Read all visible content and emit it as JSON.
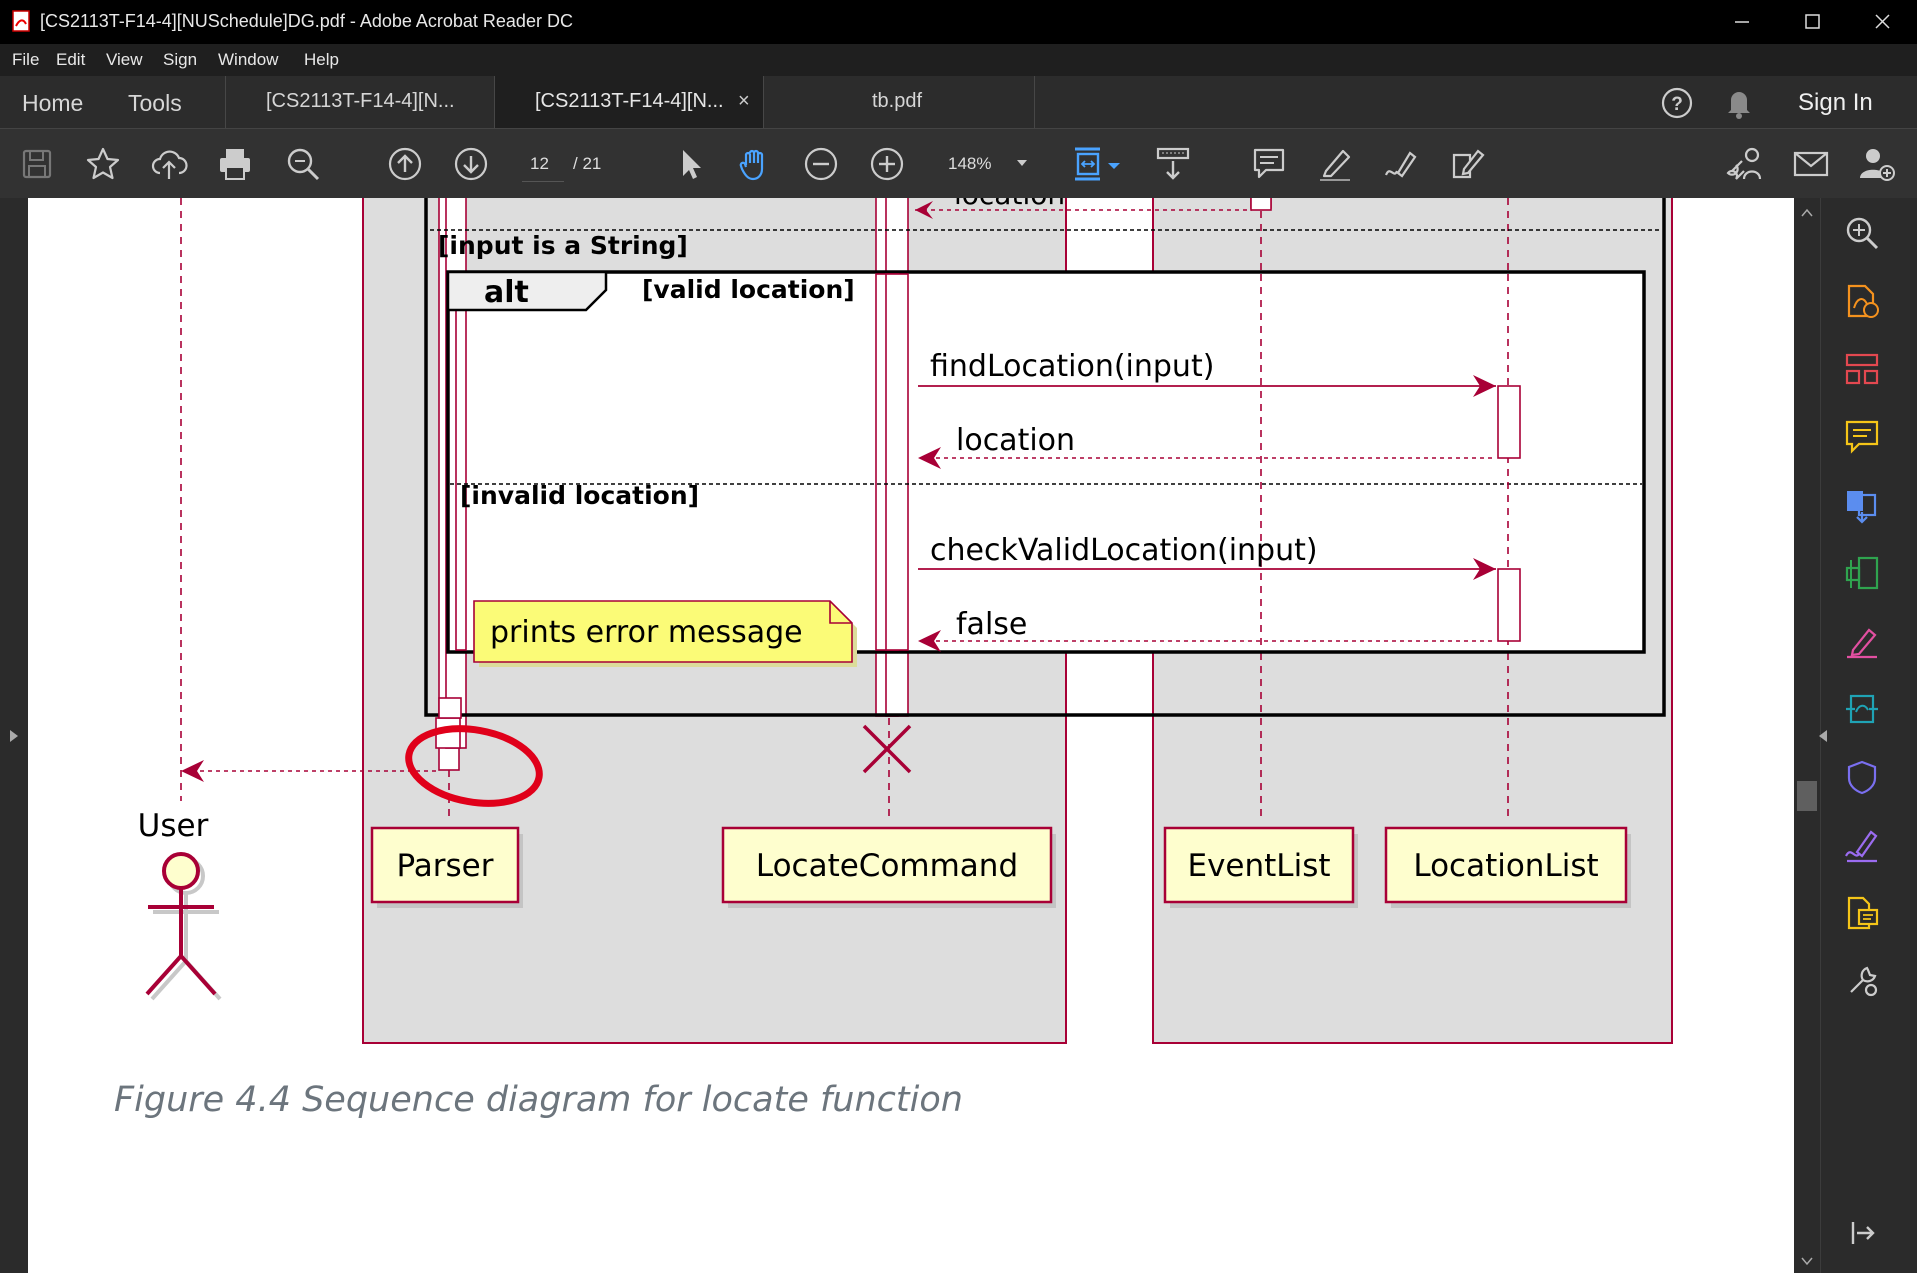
{
  "window": {
    "title": "[CS2113T-F14-4][NUSchedule]DG.pdf - Adobe Acrobat Reader DC"
  },
  "menu": {
    "items": [
      "File",
      "Edit",
      "View",
      "Sign",
      "Window",
      "Help"
    ]
  },
  "tabs": {
    "home": "Home",
    "tools": "Tools",
    "doc1": "[CS2113T-F14-4][N...",
    "doc2": "[CS2113T-F14-4][N...",
    "doc2_close": "×",
    "doc3": "tb.pdf",
    "sign_in": "Sign In"
  },
  "toolbar": {
    "page_current": "12",
    "page_total": "/ 21",
    "zoom": "148%"
  },
  "diagram": {
    "guard_string": "[input is a String]",
    "alt_keyword": "alt",
    "guard_valid": "[valid location]",
    "guard_invalid": "[invalid location]",
    "top_return_partial": "location",
    "msg_find": "findLocation(input)",
    "ret_location": "location",
    "msg_check": "checkValidLocation(input)",
    "ret_false": "false",
    "note": "prints error message",
    "participants": {
      "user": "User",
      "parser": "Parser",
      "locate_command": "LocateCommand",
      "event_list": "EventList",
      "location_list": "LocationList"
    },
    "colors": {
      "line": "#a80036",
      "participant_fill": "#fefece",
      "note_fill": "#fbfb77",
      "group_fill": "#dddddd",
      "annotation": "#e0001a"
    }
  },
  "caption": "Figure 4.4 Sequence diagram for locate function",
  "icons": {
    "toolbar": [
      "save-icon",
      "bookmark-star-icon",
      "upload-cloud-icon",
      "print-icon",
      "zoom-search-icon",
      "page-up-icon",
      "page-down-icon",
      "select-arrow-icon",
      "hand-icon",
      "zoom-out-icon",
      "zoom-in-icon",
      "fit-page-icon",
      "scroll-mode-icon",
      "comment-icon",
      "highlight-pen-icon",
      "draw-icon",
      "fill-sign-icon",
      "share-link-icon",
      "email-icon",
      "add-user-icon"
    ],
    "right_panel": [
      "search-zoom-icon",
      "export-pdf-icon",
      "organize-pages-icon",
      "comment-icon",
      "combine-files-icon",
      "edit-pdf-icon",
      "fill-sign-icon",
      "send-review-icon",
      "protect-icon",
      "signature-icon",
      "compare-icon",
      "more-tools-icon",
      "collapse-panel-icon"
    ]
  }
}
